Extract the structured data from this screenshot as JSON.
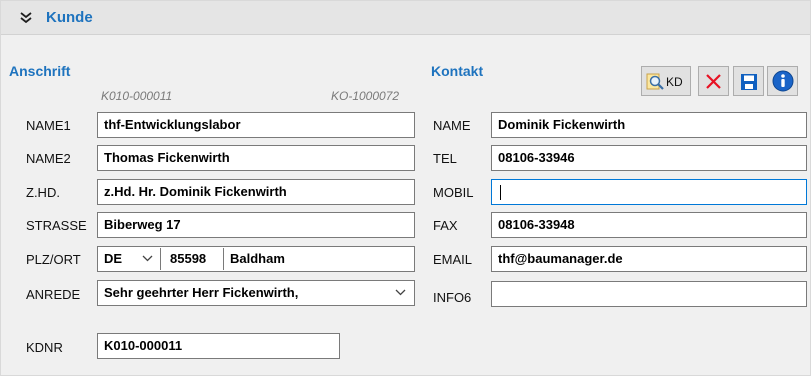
{
  "panel": {
    "title": "Kunde"
  },
  "anschrift": {
    "title": "Anschrift",
    "meta_left": "K010-000011",
    "meta_right": "KO-1000072",
    "name1": {
      "label": "NAME1",
      "value": "thf-Entwicklungslabor"
    },
    "name2": {
      "label": "NAME2",
      "value": "Thomas Fickenwirth"
    },
    "zhd": {
      "label": "Z.HD.",
      "value": "z.Hd. Hr. Dominik Fickenwirth"
    },
    "strasse": {
      "label": "STRASSE",
      "value": "Biberweg 17"
    },
    "plzort": {
      "label": "PLZ/ORT",
      "country": "DE",
      "plz": "85598",
      "ort": "Baldham"
    },
    "anrede": {
      "label": "ANREDE",
      "value": "Sehr geehrter Herr Fickenwirth,"
    },
    "kdnr": {
      "label": "KDNR",
      "value": "K010-000011"
    }
  },
  "kontakt": {
    "title": "Kontakt",
    "name": {
      "label": "NAME",
      "value": "Dominik Fickenwirth"
    },
    "tel": {
      "label": "TEL",
      "value": "08106-33946"
    },
    "mobil": {
      "label": "MOBIL",
      "value": ""
    },
    "fax": {
      "label": "FAX",
      "value": "08106-33948"
    },
    "email": {
      "label": "EMAIL",
      "value": "thf@baumanager.de"
    },
    "info6": {
      "label": "INFO6",
      "value": ""
    }
  },
  "toolbar": {
    "search_kd_label": "KD",
    "icons": [
      "search-kd-icon",
      "delete-icon",
      "save-icon",
      "info-icon"
    ]
  },
  "colors": {
    "accent": "#1e73be",
    "delete": "#e81123",
    "save": "#1060c0",
    "info": "#1a64c8",
    "focus": "#0078d7"
  }
}
